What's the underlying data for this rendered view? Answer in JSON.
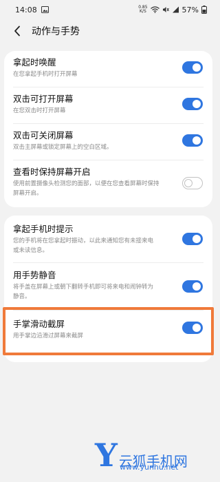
{
  "status_bar": {
    "time": "14:08",
    "net_speed_value": "0.85",
    "net_speed_unit": "K/S",
    "battery": "57%"
  },
  "header": {
    "title": "动作与手势"
  },
  "group1": [
    {
      "title": "拿起时唤醒",
      "desc": "在您拿起手机时打开屏幕",
      "on": true
    },
    {
      "title": "双击可打开屏幕",
      "desc": "在您双击时打开屏幕",
      "on": true
    },
    {
      "title": "双击可关闭屏幕",
      "desc": "双击主屏幕或锁定屏幕上的空白区域。",
      "on": true
    },
    {
      "title": "查看时保持屏幕开启",
      "desc_line1": "使用前置摄像头检测您的面部，以便在您查看屏幕时保持",
      "desc_line2": "屏幕开启。",
      "on": false
    }
  ],
  "group2": [
    {
      "title": "拿起手机时提示",
      "desc_line1": "您的手机将在您拿起时振动，以此来通知您有未接来电",
      "desc_line2": "或未读信息。",
      "on": true
    },
    {
      "title": "用手势静音",
      "desc_line1": "将手盖在屏幕上或朝下翻转手机即可将来电和闹钟转为",
      "desc_line2": "静音。",
      "on": true
    },
    {
      "title": "手掌滑动截屏",
      "desc": "用手掌边沿滑过屏幕来截屏",
      "on": true
    }
  ],
  "watermark": {
    "letter": "Y",
    "name": "云狐手机网",
    "url": "www.yunhu.net"
  },
  "colors": {
    "accent": "#2f76e0",
    "highlight": "#f07a3a"
  }
}
